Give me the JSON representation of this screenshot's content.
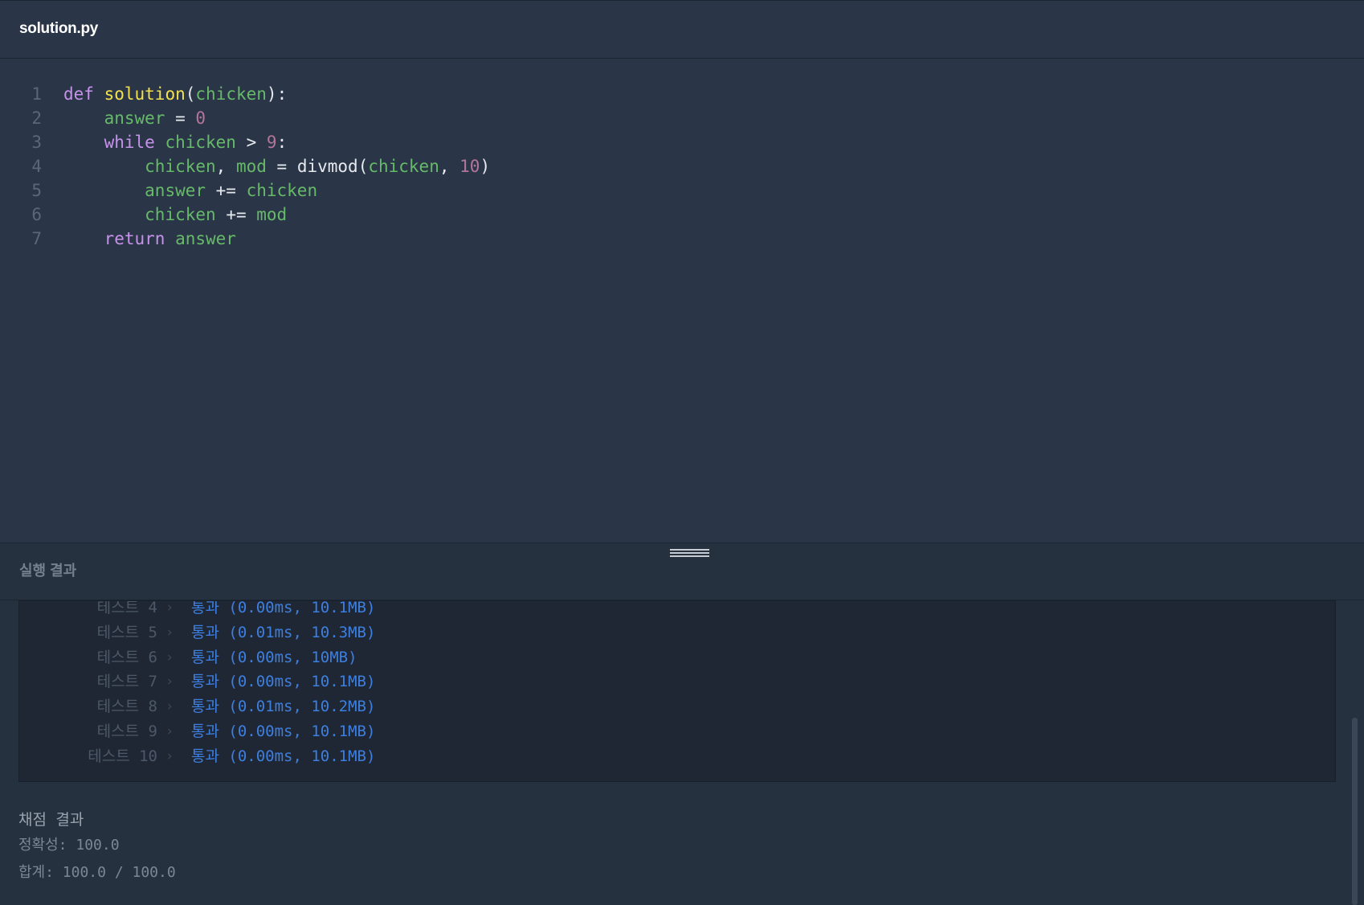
{
  "editor": {
    "file_name": "solution.py",
    "lines": [
      {
        "num": "1",
        "tokens": [
          [
            "kw",
            "def"
          ],
          [
            "op",
            " "
          ],
          [
            "fn",
            "solution"
          ],
          [
            "op",
            "("
          ],
          [
            "var",
            "chicken"
          ],
          [
            "op",
            "):"
          ]
        ]
      },
      {
        "num": "2",
        "tokens": [
          [
            "op",
            "    "
          ],
          [
            "var",
            "answer"
          ],
          [
            "op",
            " = "
          ],
          [
            "num",
            "0"
          ]
        ]
      },
      {
        "num": "3",
        "tokens": [
          [
            "op",
            "    "
          ],
          [
            "kw",
            "while"
          ],
          [
            "op",
            " "
          ],
          [
            "var",
            "chicken"
          ],
          [
            "op",
            " > "
          ],
          [
            "num",
            "9"
          ],
          [
            "op",
            ":"
          ]
        ]
      },
      {
        "num": "4",
        "tokens": [
          [
            "op",
            "        "
          ],
          [
            "var",
            "chicken"
          ],
          [
            "op",
            ", "
          ],
          [
            "var",
            "mod"
          ],
          [
            "op",
            " = divmod("
          ],
          [
            "var",
            "chicken"
          ],
          [
            "op",
            ", "
          ],
          [
            "num",
            "10"
          ],
          [
            "op",
            ")"
          ]
        ]
      },
      {
        "num": "5",
        "tokens": [
          [
            "op",
            "        "
          ],
          [
            "var",
            "answer"
          ],
          [
            "op",
            " += "
          ],
          [
            "var",
            "chicken"
          ]
        ]
      },
      {
        "num": "6",
        "tokens": [
          [
            "op",
            "        "
          ],
          [
            "var",
            "chicken"
          ],
          [
            "op",
            " += "
          ],
          [
            "var",
            "mod"
          ]
        ]
      },
      {
        "num": "7",
        "tokens": [
          [
            "op",
            "    "
          ],
          [
            "kw",
            "return"
          ],
          [
            "op",
            " "
          ],
          [
            "var",
            "answer"
          ]
        ]
      }
    ]
  },
  "results": {
    "title": "실행 결과",
    "tests": [
      {
        "label": "테스트 4",
        "result": "통과 (0.00ms, 10.1MB)"
      },
      {
        "label": "테스트 5",
        "result": "통과 (0.01ms, 10.3MB)"
      },
      {
        "label": "테스트 6",
        "result": "통과 (0.00ms, 10MB)"
      },
      {
        "label": "테스트 7",
        "result": "통과 (0.00ms, 10.1MB)"
      },
      {
        "label": "테스트 8",
        "result": "통과 (0.01ms, 10.2MB)"
      },
      {
        "label": "테스트 9",
        "result": "통과 (0.00ms, 10.1MB)"
      },
      {
        "label": "테스트 10",
        "result": "통과 (0.00ms, 10.1MB)"
      }
    ],
    "chevron_icon": "chevron-right-icon",
    "grading": {
      "title": "채점 결과",
      "accuracy": "정확성: 100.0",
      "total": "합계: 100.0 / 100.0"
    }
  },
  "colors": {
    "pass": "#3d7fdf",
    "keyword": "#c792ea",
    "function": "#f3e14e",
    "variable": "#67b96a",
    "number": "#b3759a"
  }
}
